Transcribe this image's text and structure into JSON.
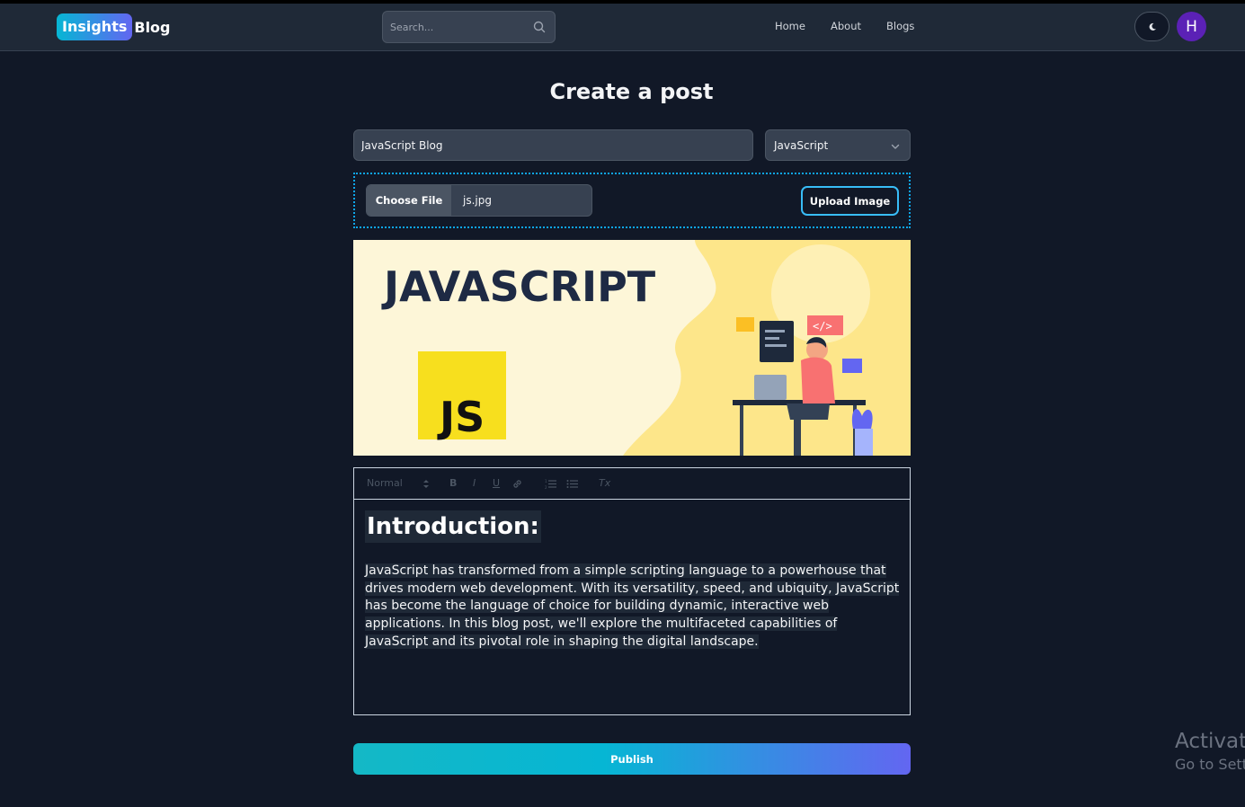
{
  "header": {
    "logo_badge": "Insights",
    "logo_text": "Blog",
    "search_placeholder": "Search...",
    "nav": [
      "Home",
      "About",
      "Blogs"
    ],
    "avatar_initial": "H"
  },
  "page": {
    "title": "Create a post"
  },
  "form": {
    "title_value": "JavaScript Blog",
    "category_value": "JavaScript",
    "choose_file_label": "Choose File",
    "file_name": "js.jpg",
    "upload_label": "Upload Image",
    "publish_label": "Publish"
  },
  "banner": {
    "heading": "JAVASCRIPT",
    "badge": "JS"
  },
  "editor": {
    "toolbar": {
      "format": "Normal",
      "bold": "B",
      "italic": "I",
      "underline": "U",
      "clear": "Tx"
    },
    "heading": "Introduction:",
    "paragraph": "JavaScript has transformed from a simple scripting language to a powerhouse that drives modern web development. With its versatility, speed, and ubiquity, JavaScript has become the language of choice for building dynamic, interactive web applications. In this blog post, we'll explore the multifaceted capabilities of JavaScript and its pivotal role in shaping the digital landscape."
  },
  "watermark": {
    "line1": "Activate",
    "line2": "Go to Settings"
  }
}
